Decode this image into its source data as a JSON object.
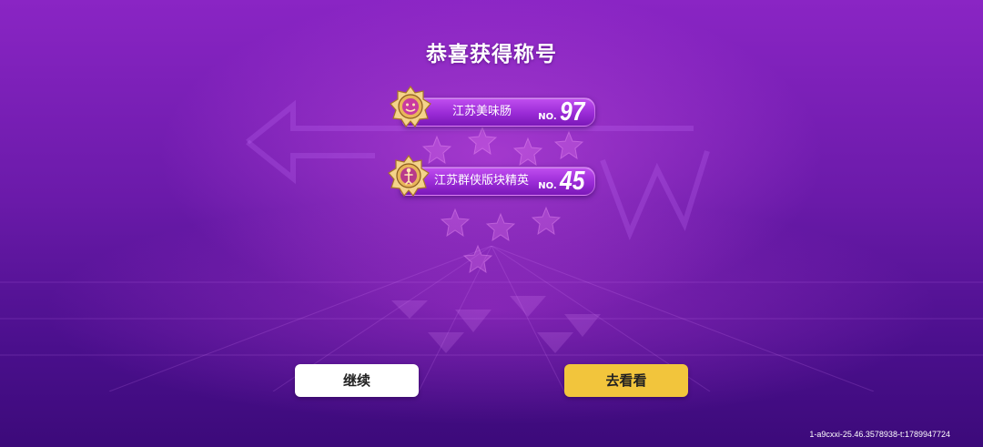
{
  "title": "恭喜获得称号",
  "titles": [
    {
      "name": "江苏美味肠",
      "rank_prefix": "NO.",
      "rank": "97",
      "emblem_icon": "gold-medal-face-icon"
    },
    {
      "name": "江苏群侠版块精英",
      "rank_prefix": "NO.",
      "rank": "45",
      "emblem_icon": "gold-medal-figure-icon"
    }
  ],
  "buttons": {
    "continue": "继续",
    "view": "去看看"
  },
  "build_id": "1-a9cxxi-25.46.3578938-t:1789947724",
  "colors": {
    "background": "#6a1aa9",
    "bar": "#9a2bd6",
    "view_button": "#f2c53c",
    "continue_button": "#ffffff"
  }
}
